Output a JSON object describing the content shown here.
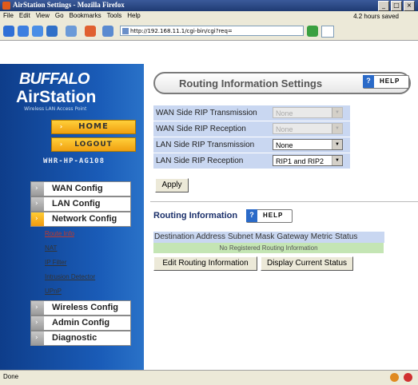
{
  "window": {
    "title": "AirStation Settings - Mozilla Firefox",
    "btn_min": "_",
    "btn_max": "□",
    "btn_close": "×"
  },
  "menubar": {
    "items": [
      "File",
      "Edit",
      "View",
      "Go",
      "Bookmarks",
      "Tools",
      "Help"
    ],
    "saved_text": "4.2 hours saved"
  },
  "navbar": {
    "url": "http://192.168.11.1/cgi-bin/cgi?req="
  },
  "sidebar": {
    "brand": "BUFFALO",
    "product": "AirStation",
    "tagline": "Wireless LAN Access Point",
    "home_label": "HOME",
    "logout_label": "LOGOUT",
    "model": "WHR-HP-AG108",
    "nav": [
      "WAN Config",
      "LAN Config",
      "Network Config"
    ],
    "subnav": [
      "Route Info",
      "NAT",
      "IP Filter",
      "Intrusion Detector",
      "UPnP"
    ],
    "nav2": [
      "Wireless Config",
      "Admin Config",
      "Diagnostic"
    ],
    "arrow_glyph": "›"
  },
  "main": {
    "title": "Routing Information Settings",
    "help_label": "HELP",
    "help_glyph": "?",
    "rip": [
      {
        "label": "WAN Side RIP Transmission",
        "value": "None",
        "disabled": true
      },
      {
        "label": "WAN Side RIP Reception",
        "value": "None",
        "disabled": true
      },
      {
        "label": "LAN Side RIP Transmission",
        "value": "None",
        "disabled": false
      },
      {
        "label": "LAN Side RIP Reception",
        "value": "RIP1 and RIP2",
        "disabled": false
      }
    ],
    "apply_label": "Apply",
    "routing_header": "Routing Information",
    "table_headers": [
      "Destination Address",
      "Subnet Mask",
      "Gateway",
      "Metric",
      "Status"
    ],
    "no_routes": "No Registered Routing Information",
    "edit_label": "Edit Routing Information",
    "status_label": "Display Current Status"
  },
  "statusbar": {
    "text": "Done"
  },
  "colors": {
    "sidebar": "#1a5cb8",
    "row_blue": "#c9d7f1",
    "row_green": "#c4e5b4",
    "accent": "#f0a010"
  }
}
